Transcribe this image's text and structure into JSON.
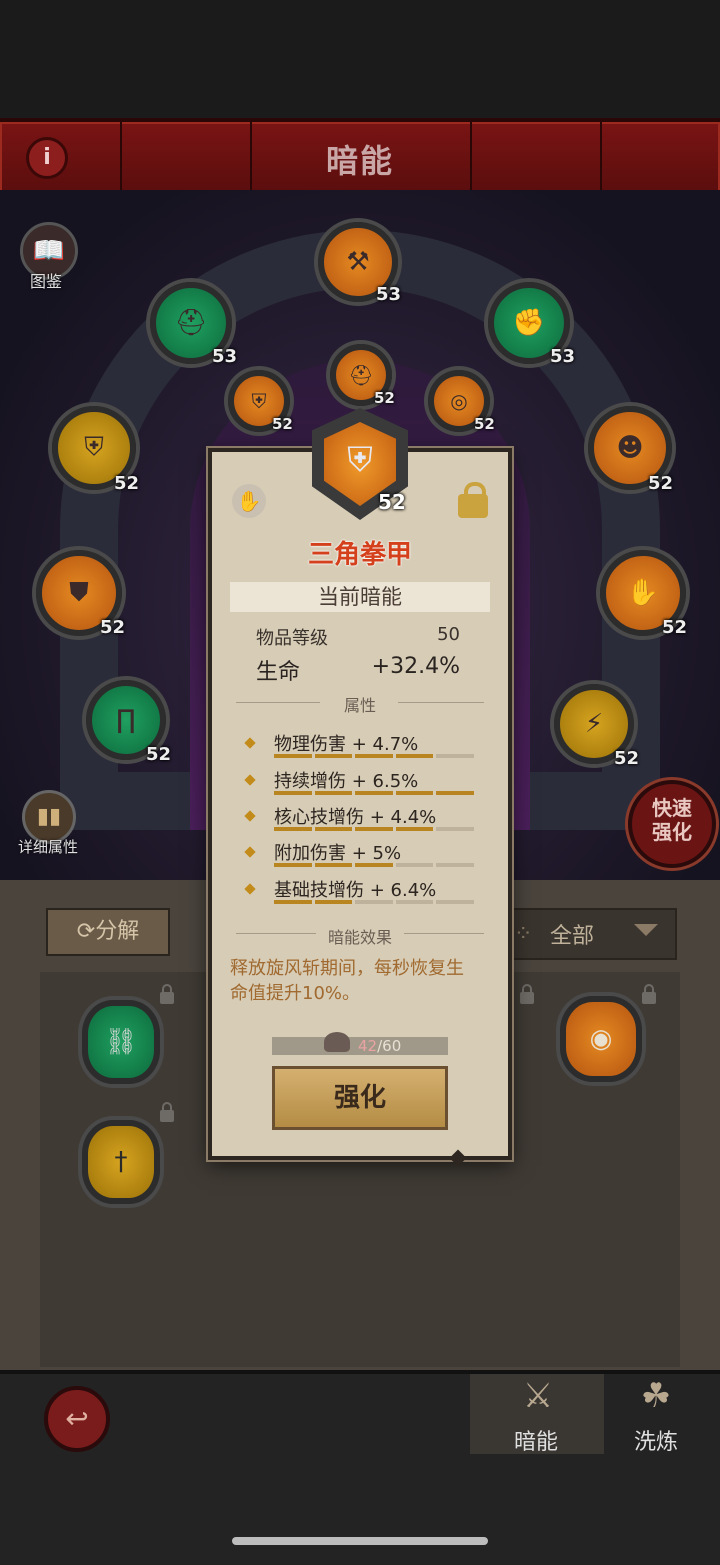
{
  "header": {
    "title": "暗能",
    "info_icon": "info-icon"
  },
  "side": {
    "codex_label": "图鉴",
    "details_label": "详细属性",
    "quick_line1": "快速",
    "quick_line2": "强化"
  },
  "nodes": {
    "top": {
      "level": "53",
      "color": "#e07a20",
      "icon": "axe-icon"
    },
    "upper_left": {
      "level": "53",
      "color": "#1a8a50",
      "icon": "helm-icon"
    },
    "upper_right": {
      "level": "53",
      "color": "#1a8a50",
      "icon": "gauntlet-icon"
    },
    "inner_left": {
      "level": "52",
      "color": "#e07a20",
      "icon": "chest-icon"
    },
    "inner_center": {
      "level": "52",
      "color": "#e07a20",
      "icon": "helm-icon"
    },
    "inner_right": {
      "level": "52",
      "color": "#e07a20",
      "icon": "ring-icon"
    },
    "mid_left": {
      "level": "52",
      "color": "#c9961a",
      "icon": "chest-icon"
    },
    "mid_right": {
      "level": "52",
      "color": "#e07a20",
      "icon": "mask-icon"
    },
    "low_left": {
      "level": "52",
      "color": "#e07a20",
      "icon": "shoulder-icon"
    },
    "low_right": {
      "level": "52",
      "color": "#e07a20",
      "icon": "glove-icon"
    },
    "bottom_left": {
      "level": "52",
      "color": "#1a8a50",
      "icon": "pants-icon"
    },
    "bottom_right": {
      "level": "52",
      "color": "#c9961a",
      "icon": "boots-icon"
    }
  },
  "lower": {
    "decompose_label": "分解",
    "filter_label": "全部"
  },
  "popup": {
    "item_level": "52",
    "item_name": "三角拳甲",
    "section_current": "当前暗能",
    "item_level_label": "物品等级",
    "item_level_value": "50",
    "life_label": "生命",
    "life_value": "+32.4%",
    "attr_title": "属性",
    "attributes": [
      {
        "text": "物理伤害 + 4.7%",
        "fill": 4,
        "total": 5
      },
      {
        "text": "持续增伤 + 6.5%",
        "fill": 5,
        "total": 5
      },
      {
        "text": "核心技增伤 + 4.4%",
        "fill": 4,
        "total": 5
      },
      {
        "text": "附加伤害 + 5%",
        "fill": 3,
        "total": 5
      },
      {
        "text": "基础技增伤 + 6.4%",
        "fill": 2,
        "total": 5
      }
    ],
    "effect_title": "暗能效果",
    "effect_text": "释放旋风斩期间，每秒恢复生命值提升10%。",
    "material_have": "42",
    "material_need": "/60",
    "upgrade_label": "强化"
  },
  "nav": {
    "tab1_label": "暗能",
    "tab2_label": "洗炼"
  }
}
